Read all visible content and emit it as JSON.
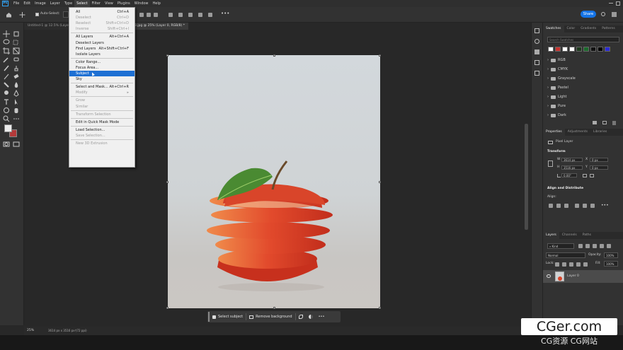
{
  "menubar": {
    "logo": "Ps",
    "items": [
      "File",
      "Edit",
      "Image",
      "Layer",
      "Type",
      "Select",
      "Filter",
      "View",
      "Plugins",
      "Window",
      "Help"
    ],
    "active": "Select"
  },
  "options": {
    "auto_select_label": "Auto-Select:",
    "share_label": "Share"
  },
  "tabs": [
    {
      "label": "Untitled-1 @ 12.5% (Layer 1, RGB/8) *",
      "active": false
    },
    {
      "label": "...ofoto-680076-1650588.jpg @ 25% (Layer 0, RGB/8) *",
      "active": true
    }
  ],
  "select_menu": [
    {
      "label": "All",
      "shortcut": "Ctrl+A",
      "disabled": false
    },
    {
      "label": "Deselect",
      "shortcut": "Ctrl+D",
      "disabled": true
    },
    {
      "label": "Reselect",
      "shortcut": "Shift+Ctrl+D",
      "disabled": true
    },
    {
      "label": "Inverse",
      "shortcut": "Shift+Ctrl+I",
      "disabled": true
    },
    {
      "sep": true
    },
    {
      "label": "All Layers",
      "shortcut": "Alt+Ctrl+A",
      "disabled": false
    },
    {
      "label": "Deselect Layers",
      "shortcut": "",
      "disabled": false
    },
    {
      "label": "Find Layers",
      "shortcut": "Alt+Shift+Ctrl+F",
      "disabled": false
    },
    {
      "label": "Isolate Layers",
      "shortcut": "",
      "disabled": false
    },
    {
      "sep": true
    },
    {
      "label": "Color Range...",
      "shortcut": "",
      "disabled": false
    },
    {
      "label": "Focus Area...",
      "shortcut": "",
      "disabled": false
    },
    {
      "label": "Subject",
      "shortcut": "",
      "disabled": false,
      "highlighted": true
    },
    {
      "label": "Sky",
      "shortcut": "",
      "disabled": false
    },
    {
      "sep": true
    },
    {
      "label": "Select and Mask...",
      "shortcut": "Alt+Ctrl+R",
      "disabled": false
    },
    {
      "label": "Modify",
      "shortcut": "▸",
      "disabled": true
    },
    {
      "sep": true
    },
    {
      "label": "Grow",
      "shortcut": "",
      "disabled": true
    },
    {
      "label": "Similar",
      "shortcut": "",
      "disabled": true
    },
    {
      "sep": true
    },
    {
      "label": "Transform Selection",
      "shortcut": "",
      "disabled": true
    },
    {
      "sep": true
    },
    {
      "label": "Edit in Quick Mask Mode",
      "shortcut": "",
      "disabled": false
    },
    {
      "sep": true
    },
    {
      "label": "Load Selection...",
      "shortcut": "",
      "disabled": false
    },
    {
      "label": "Save Selection...",
      "shortcut": "",
      "disabled": true
    },
    {
      "sep": true
    },
    {
      "label": "New 3D Extrusion",
      "shortcut": "",
      "disabled": true
    }
  ],
  "context_bar": {
    "select_subject": "Select subject",
    "remove_background": "Remove background",
    "more": "•••"
  },
  "status": {
    "zoom": "25%",
    "doc_size": "3614 px x 3516 px (72 ppi)"
  },
  "swatches_panel": {
    "tabs": [
      "Swatches",
      "Color",
      "Gradients",
      "Patterns"
    ],
    "search_placeholder": "Search Swatches",
    "swatch_colors": [
      "#ffffff",
      "#c8332f",
      "#ffffff",
      "#ffffff",
      "#1e3a1e",
      "#1b6b2c",
      "#111111",
      "#000000",
      "#2b2bd6"
    ],
    "folders": [
      "RGB",
      "CMYK",
      "Grayscale",
      "Pastel",
      "Light",
      "Pure",
      "Dark"
    ]
  },
  "properties_panel": {
    "tabs": [
      "Properties",
      "Adjustments",
      "Libraries"
    ],
    "pixel_layer": "Pixel Layer",
    "transform_header": "Transform",
    "w_label": "W",
    "w_value": "3614 px",
    "h_label": "H",
    "h_value": "3516 px",
    "x_label": "X",
    "x_value": "0 px",
    "y_label": "Y",
    "y_value": "0 px",
    "angle_value": "0.00°",
    "align_header": "Align and Distribute",
    "align_label": "Align:"
  },
  "layers_panel": {
    "tabs": [
      "Layers",
      "Channels",
      "Paths"
    ],
    "kind_label": "Kind",
    "blend_mode": "Normal",
    "opacity_label": "Opacity:",
    "opacity_value": "100%",
    "lock_label": "Lock:",
    "fill_label": "Fill:",
    "fill_value": "100%",
    "layer_name": "Layer 0"
  },
  "watermark": {
    "main": "CGer.com",
    "sub": "CG资源 CG网站"
  }
}
